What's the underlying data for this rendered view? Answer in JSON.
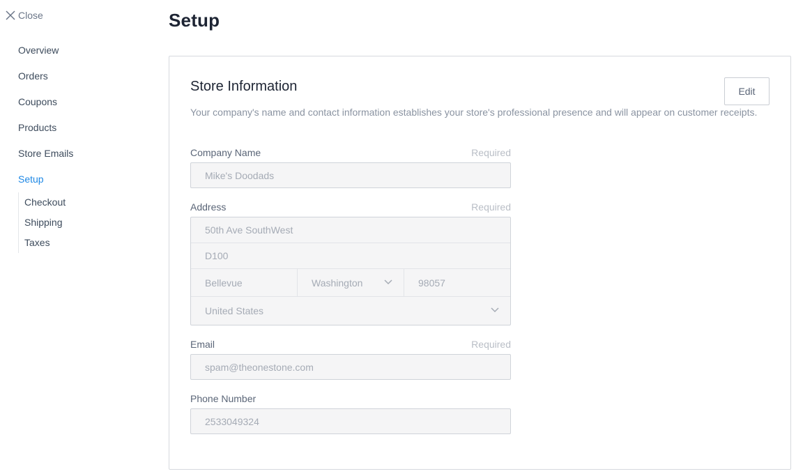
{
  "sidebar": {
    "close_label": "Close",
    "items": [
      {
        "label": "Overview"
      },
      {
        "label": "Orders"
      },
      {
        "label": "Coupons"
      },
      {
        "label": "Products"
      },
      {
        "label": "Store Emails"
      },
      {
        "label": "Setup",
        "active": true
      }
    ],
    "subitems": [
      {
        "label": "Checkout"
      },
      {
        "label": "Shipping"
      },
      {
        "label": "Taxes"
      }
    ]
  },
  "page": {
    "title": "Setup"
  },
  "store_info": {
    "title": "Store Information",
    "edit_label": "Edit",
    "description": "Your company's name and contact information establishes your store's professional presence and will appear on customer receipts.",
    "company_name": {
      "label": "Company Name",
      "required": "Required",
      "value": "Mike's Doodads"
    },
    "address": {
      "label": "Address",
      "required": "Required",
      "line1": "50th Ave SouthWest",
      "line2": "D100",
      "city": "Bellevue",
      "state": "Washington",
      "zip": "98057",
      "country": "United States"
    },
    "email": {
      "label": "Email",
      "required": "Required",
      "value": "spam@theonestone.com"
    },
    "phone": {
      "label": "Phone Number",
      "value": "2533049324"
    }
  },
  "colors": {
    "accent": "#1e88e5",
    "text": "#3d4b5c",
    "muted": "#a5abb5",
    "border": "#cfd3d9"
  }
}
